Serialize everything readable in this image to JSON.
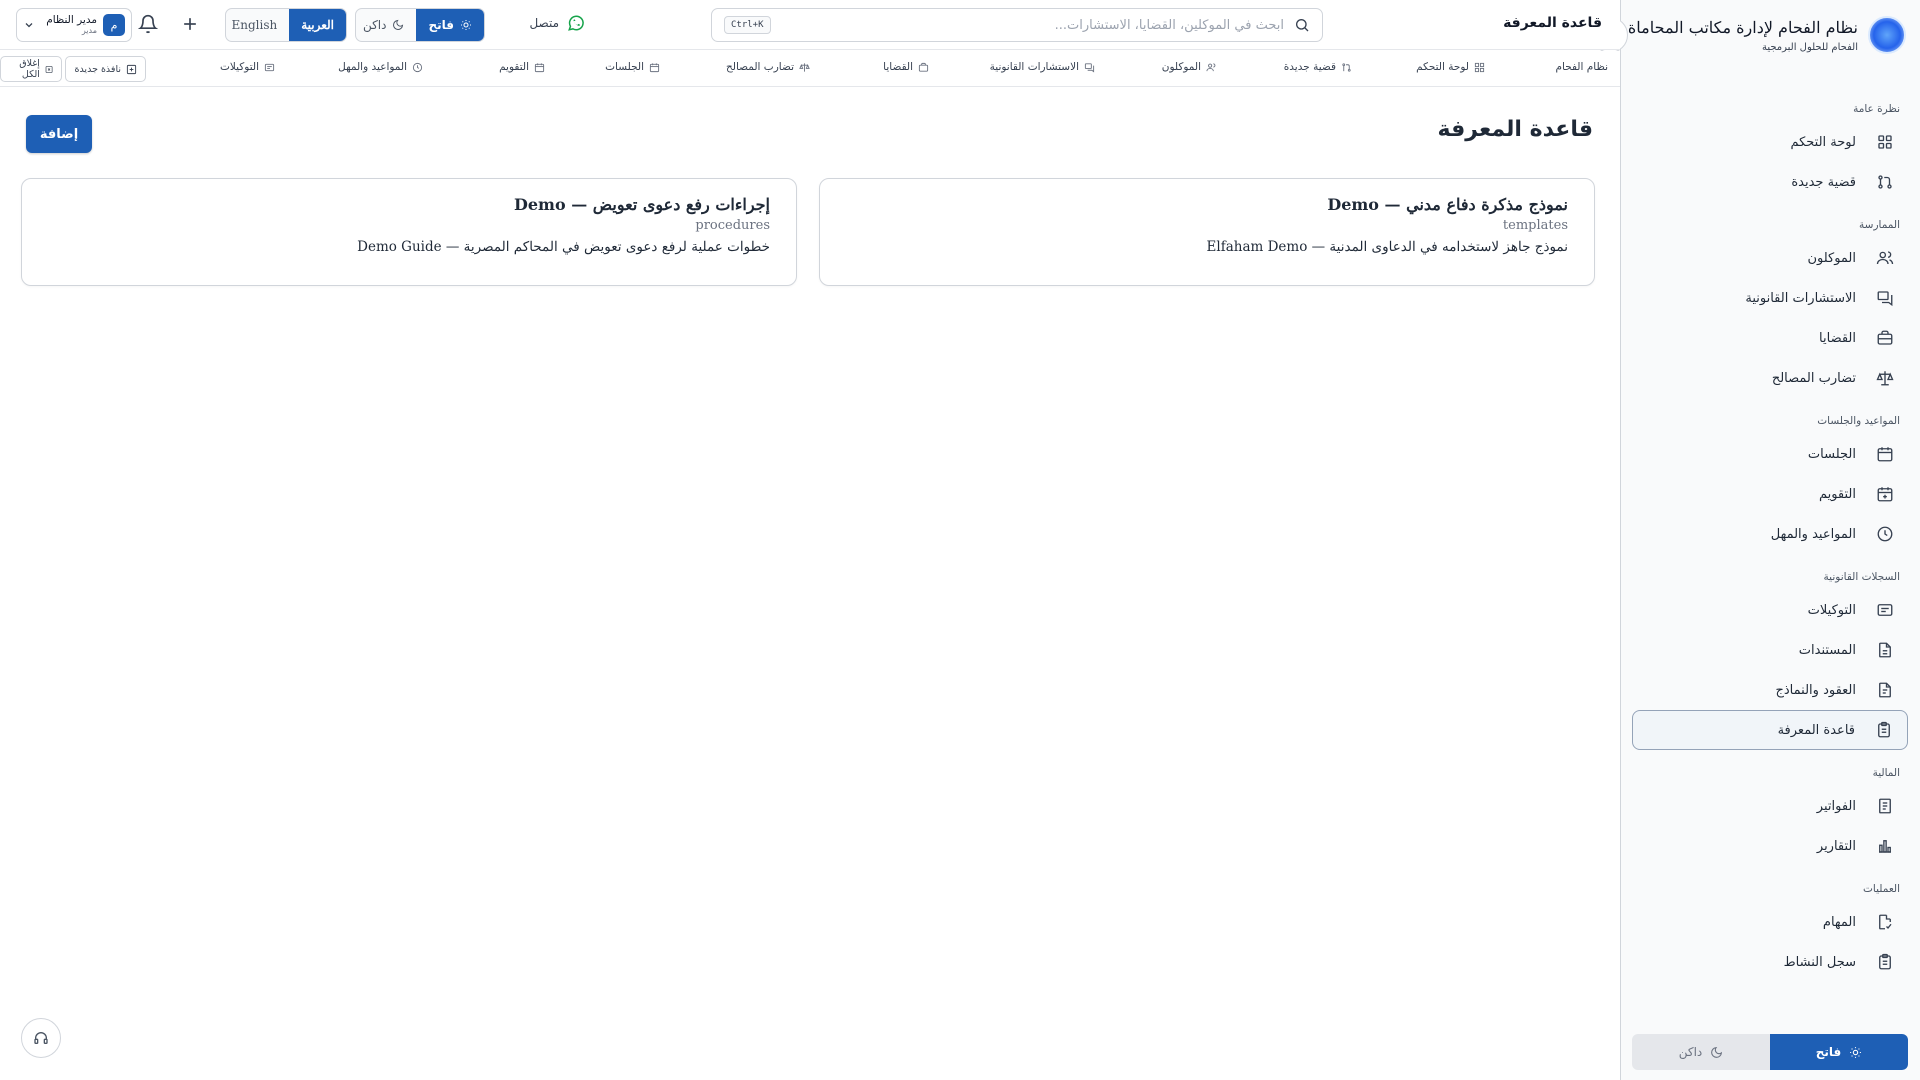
{
  "brand": {
    "title": "نظام الفحام لإدارة مكاتب المحاماة",
    "subtitle": "الفحام للحلول البرمجية"
  },
  "topbar": {
    "title": "قاعدة المعرفة",
    "search_placeholder": "ابحث في الموكلين، القضايا، الاستشارات...",
    "search_shortcut": "Ctrl+K",
    "status": "متصل",
    "theme": {
      "light": "فاتح",
      "dark": "داكن"
    },
    "lang": {
      "ar": "العربية",
      "en": "English"
    },
    "user": {
      "name": "مدير النظام",
      "role": "مدير",
      "initial": "م"
    }
  },
  "tabs": [
    "نظام الفحام",
    "لوحة التحكم",
    "قضية جديدة",
    "الموكلون",
    "الاستشارات القانونية",
    "القضايا",
    "تضارب المصالح",
    "الجلسات",
    "التقويم",
    "المواعيد والمهل",
    "التوكيلات"
  ],
  "tab_actions": {
    "new_window": "نافذة جديدة",
    "close_all": "إغلاق الكل"
  },
  "sidebar": {
    "sections": [
      {
        "title": "نظرة عامة",
        "items": [
          {
            "label": "لوحة التحكم",
            "icon": "dashboard-icon"
          },
          {
            "label": "قضية جديدة",
            "icon": "git-pull-icon"
          }
        ]
      },
      {
        "title": "الممارسة",
        "items": [
          {
            "label": "الموكلون",
            "icon": "users-icon"
          },
          {
            "label": "الاستشارات القانونية",
            "icon": "messages-icon"
          },
          {
            "label": "القضايا",
            "icon": "briefcase-icon"
          },
          {
            "label": "تضارب المصالح",
            "icon": "scale-icon"
          }
        ]
      },
      {
        "title": "المواعيد والجلسات",
        "items": [
          {
            "label": "الجلسات",
            "icon": "calendar-icon"
          },
          {
            "label": "التقويم",
            "icon": "calendar-plus-icon"
          },
          {
            "label": "المواعيد والمهل",
            "icon": "clock-icon"
          }
        ]
      },
      {
        "title": "السجلات القانونية",
        "items": [
          {
            "label": "التوكيلات",
            "icon": "stamp-icon"
          },
          {
            "label": "المستندات",
            "icon": "document-icon"
          },
          {
            "label": "العقود والنماذج",
            "icon": "document-text-icon"
          },
          {
            "label": "قاعدة المعرفة",
            "icon": "clipboard-icon",
            "active": true
          }
        ]
      },
      {
        "title": "المالية",
        "items": [
          {
            "label": "الفواتير",
            "icon": "receipt-icon"
          },
          {
            "label": "التقارير",
            "icon": "bar-chart-icon"
          }
        ]
      },
      {
        "title": "العمليات",
        "items": [
          {
            "label": "المهام",
            "icon": "task-icon"
          },
          {
            "label": "سجل النشاط",
            "icon": "clipboard-list-icon"
          }
        ]
      }
    ],
    "theme": {
      "light": "فاتح",
      "dark": "داكن"
    }
  },
  "main": {
    "title": "قاعدة المعرفة",
    "add_label": "إضافة",
    "cards": [
      {
        "title": "نموذج مذكرة دفاع مدني — Demo",
        "category": "templates",
        "description": "نموذج جاهز لاستخدامه في الدعاوى المدنية — Elfaham Demo"
      },
      {
        "title": "إجراءات رفع دعوى تعويض — Demo",
        "category": "procedures",
        "description": "خطوات عملية لرفع دعوى تعويض في المحاكم المصرية — Demo Guide"
      }
    ]
  },
  "colors": {
    "primary": "#1e5fb5",
    "whatsapp": "#16a34a"
  }
}
